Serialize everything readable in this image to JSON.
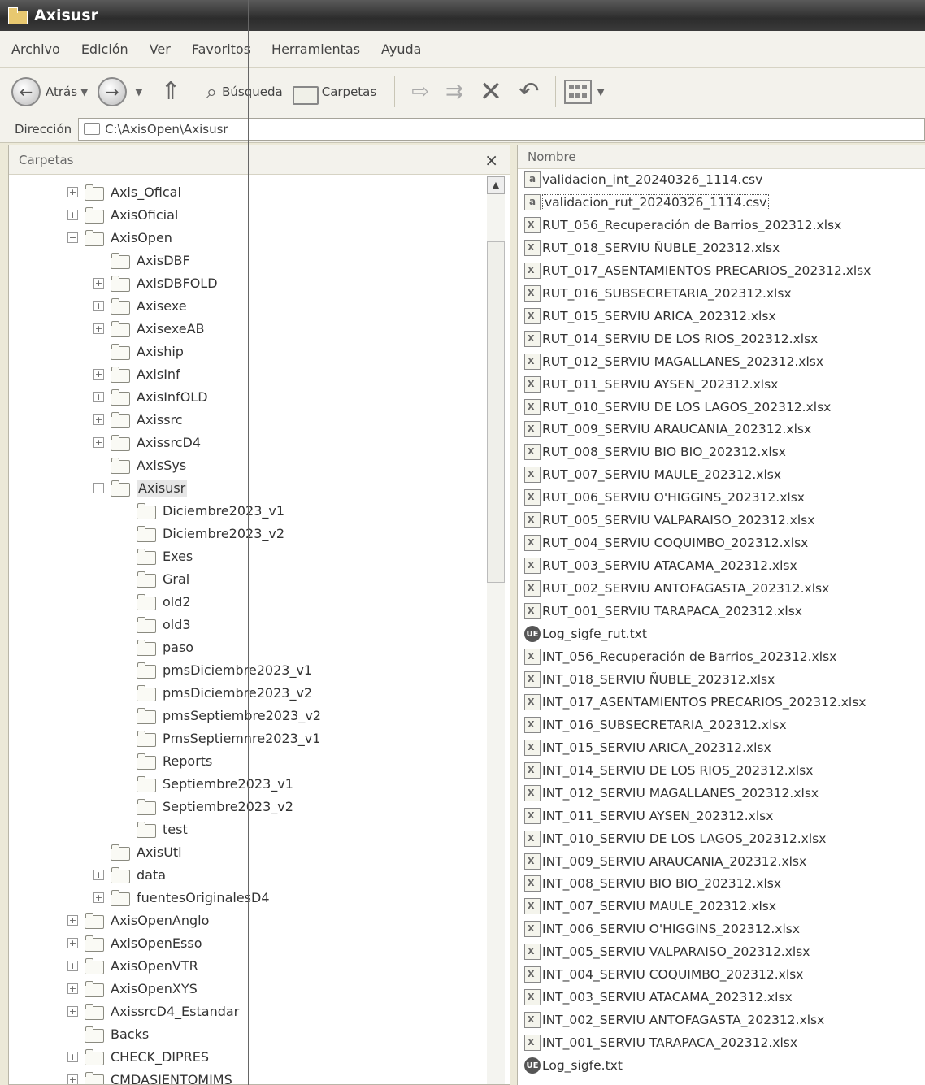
{
  "window": {
    "title": "Axisusr"
  },
  "menu": [
    "Archivo",
    "Edición",
    "Ver",
    "Favoritos",
    "Herramientas",
    "Ayuda"
  ],
  "toolbar": {
    "back_label": "Atrás",
    "search_label": "Búsqueda",
    "folders_label": "Carpetas"
  },
  "address": {
    "label": "Dirección",
    "value": "C:\\AxisOpen\\Axisusr"
  },
  "tree": {
    "header": "Carpetas",
    "close_glyph": "×",
    "items": [
      {
        "label": "Axis_Ofical",
        "level": 0,
        "exp": "+"
      },
      {
        "label": "AxisOficial",
        "level": 0,
        "exp": "+"
      },
      {
        "label": "AxisOpen",
        "level": 0,
        "exp": "−"
      },
      {
        "label": "AxisDBF",
        "level": 1,
        "exp": ""
      },
      {
        "label": "AxisDBFOLD",
        "level": 1,
        "exp": "+"
      },
      {
        "label": "Axisexe",
        "level": 1,
        "exp": "+"
      },
      {
        "label": "AxisexeAB",
        "level": 1,
        "exp": "+"
      },
      {
        "label": "Axiship",
        "level": 1,
        "exp": ""
      },
      {
        "label": "AxisInf",
        "level": 1,
        "exp": "+"
      },
      {
        "label": "AxisInfOLD",
        "level": 1,
        "exp": "+"
      },
      {
        "label": "Axissrc",
        "level": 1,
        "exp": "+"
      },
      {
        "label": "AxissrcD4",
        "level": 1,
        "exp": "+"
      },
      {
        "label": "AxisSys",
        "level": 1,
        "exp": ""
      },
      {
        "label": "Axisusr",
        "level": 1,
        "exp": "−",
        "selected": true
      },
      {
        "label": "Diciembre2023_v1",
        "level": 2,
        "exp": ""
      },
      {
        "label": "Diciembre2023_v2",
        "level": 2,
        "exp": ""
      },
      {
        "label": "Exes",
        "level": 2,
        "exp": ""
      },
      {
        "label": "Gral",
        "level": 2,
        "exp": ""
      },
      {
        "label": "old2",
        "level": 2,
        "exp": ""
      },
      {
        "label": "old3",
        "level": 2,
        "exp": ""
      },
      {
        "label": "paso",
        "level": 2,
        "exp": ""
      },
      {
        "label": "pmsDiciembre2023_v1",
        "level": 2,
        "exp": ""
      },
      {
        "label": "pmsDiciembre2023_v2",
        "level": 2,
        "exp": ""
      },
      {
        "label": "pmsSeptiembre2023_v2",
        "level": 2,
        "exp": ""
      },
      {
        "label": "PmsSeptiemnre2023_v1",
        "level": 2,
        "exp": ""
      },
      {
        "label": "Reports",
        "level": 2,
        "exp": ""
      },
      {
        "label": "Septiembre2023_v1",
        "level": 2,
        "exp": ""
      },
      {
        "label": "Septiembre2023_v2",
        "level": 2,
        "exp": ""
      },
      {
        "label": "test",
        "level": 2,
        "exp": ""
      },
      {
        "label": "AxisUtl",
        "level": 1,
        "exp": ""
      },
      {
        "label": "data",
        "level": 1,
        "exp": "+"
      },
      {
        "label": "fuentesOriginalesD4",
        "level": 1,
        "exp": "+"
      },
      {
        "label": "AxisOpenAnglo",
        "level": 0,
        "exp": "+"
      },
      {
        "label": "AxisOpenEsso",
        "level": 0,
        "exp": "+"
      },
      {
        "label": "AxisOpenVTR",
        "level": 0,
        "exp": "+"
      },
      {
        "label": "AxisOpenXYS",
        "level": 0,
        "exp": "+"
      },
      {
        "label": "AxissrcD4_Estandar",
        "level": 0,
        "exp": "+"
      },
      {
        "label": "Backs",
        "level": 0,
        "exp": ""
      },
      {
        "label": "CHECK_DIPRES",
        "level": 0,
        "exp": "+"
      },
      {
        "label": "CMDASIENTOMIMS",
        "level": 0,
        "exp": "+"
      }
    ]
  },
  "files": {
    "column_header": "Nombre",
    "items": [
      {
        "name": "validacion_int_20240326_1114.csv",
        "type": "csv"
      },
      {
        "name": "validacion_rut_20240326_1114.csv",
        "type": "csv",
        "focused": true
      },
      {
        "name": "RUT_056_Recuperación de Barrios_202312.xlsx",
        "type": "xlsx"
      },
      {
        "name": "RUT_018_SERVIU ÑUBLE_202312.xlsx",
        "type": "xlsx"
      },
      {
        "name": "RUT_017_ASENTAMIENTOS PRECARIOS_202312.xlsx",
        "type": "xlsx"
      },
      {
        "name": "RUT_016_SUBSECRETARIA_202312.xlsx",
        "type": "xlsx"
      },
      {
        "name": "RUT_015_SERVIU ARICA_202312.xlsx",
        "type": "xlsx"
      },
      {
        "name": "RUT_014_SERVIU DE LOS RIOS_202312.xlsx",
        "type": "xlsx"
      },
      {
        "name": "RUT_012_SERVIU MAGALLANES_202312.xlsx",
        "type": "xlsx"
      },
      {
        "name": "RUT_011_SERVIU AYSEN_202312.xlsx",
        "type": "xlsx"
      },
      {
        "name": "RUT_010_SERVIU DE LOS LAGOS_202312.xlsx",
        "type": "xlsx"
      },
      {
        "name": "RUT_009_SERVIU ARAUCANIA_202312.xlsx",
        "type": "xlsx"
      },
      {
        "name": "RUT_008_SERVIU BIO BIO_202312.xlsx",
        "type": "xlsx"
      },
      {
        "name": "RUT_007_SERVIU MAULE_202312.xlsx",
        "type": "xlsx"
      },
      {
        "name": "RUT_006_SERVIU O'HIGGINS_202312.xlsx",
        "type": "xlsx"
      },
      {
        "name": "RUT_005_SERVIU VALPARAISO_202312.xlsx",
        "type": "xlsx"
      },
      {
        "name": "RUT_004_SERVIU COQUIMBO_202312.xlsx",
        "type": "xlsx"
      },
      {
        "name": "RUT_003_SERVIU ATACAMA_202312.xlsx",
        "type": "xlsx"
      },
      {
        "name": "RUT_002_SERVIU ANTOFAGASTA_202312.xlsx",
        "type": "xlsx"
      },
      {
        "name": "RUT_001_SERVIU TARAPACA_202312.xlsx",
        "type": "xlsx"
      },
      {
        "name": "Log_sigfe_rut.txt",
        "type": "txt"
      },
      {
        "name": "INT_056_Recuperación de Barrios_202312.xlsx",
        "type": "xlsx"
      },
      {
        "name": "INT_018_SERVIU ÑUBLE_202312.xlsx",
        "type": "xlsx"
      },
      {
        "name": "INT_017_ASENTAMIENTOS PRECARIOS_202312.xlsx",
        "type": "xlsx"
      },
      {
        "name": "INT_016_SUBSECRETARIA_202312.xlsx",
        "type": "xlsx"
      },
      {
        "name": "INT_015_SERVIU ARICA_202312.xlsx",
        "type": "xlsx"
      },
      {
        "name": "INT_014_SERVIU DE LOS RIOS_202312.xlsx",
        "type": "xlsx"
      },
      {
        "name": "INT_012_SERVIU MAGALLANES_202312.xlsx",
        "type": "xlsx"
      },
      {
        "name": "INT_011_SERVIU AYSEN_202312.xlsx",
        "type": "xlsx"
      },
      {
        "name": "INT_010_SERVIU DE LOS LAGOS_202312.xlsx",
        "type": "xlsx"
      },
      {
        "name": "INT_009_SERVIU ARAUCANIA_202312.xlsx",
        "type": "xlsx"
      },
      {
        "name": "INT_008_SERVIU BIO BIO_202312.xlsx",
        "type": "xlsx"
      },
      {
        "name": "INT_007_SERVIU MAULE_202312.xlsx",
        "type": "xlsx"
      },
      {
        "name": "INT_006_SERVIU O'HIGGINS_202312.xlsx",
        "type": "xlsx"
      },
      {
        "name": "INT_005_SERVIU VALPARAISO_202312.xlsx",
        "type": "xlsx"
      },
      {
        "name": "INT_004_SERVIU COQUIMBO_202312.xlsx",
        "type": "xlsx"
      },
      {
        "name": "INT_003_SERVIU ATACAMA_202312.xlsx",
        "type": "xlsx"
      },
      {
        "name": "INT_002_SERVIU ANTOFAGASTA_202312.xlsx",
        "type": "xlsx"
      },
      {
        "name": "INT_001_SERVIU TARAPACA_202312.xlsx",
        "type": "xlsx"
      },
      {
        "name": "Log_sigfe.txt",
        "type": "txt"
      }
    ]
  }
}
